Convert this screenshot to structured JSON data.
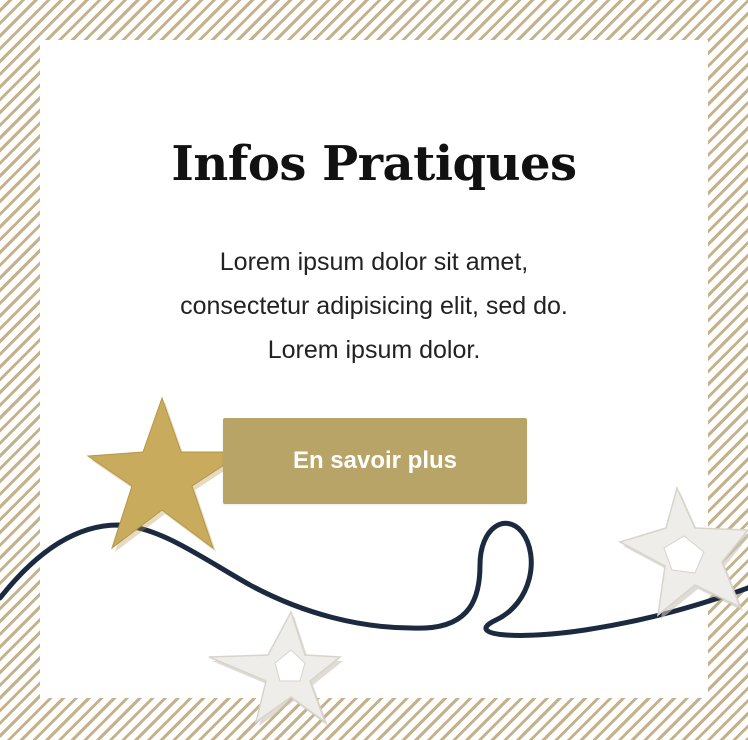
{
  "section": {
    "title": "Infos Pratiques",
    "body_lines": [
      "Lorem ipsum dolor sit amet,",
      "consectetur adipisicing elit, sed do.",
      "Lorem ipsum dolor."
    ],
    "cta_label": "En savoir plus"
  },
  "decorations": {
    "string": "navy-twine",
    "stars": [
      "gold-glitter-star-icon",
      "white-wooden-star-icon",
      "white-wooden-star-icon"
    ]
  },
  "colors": {
    "stripe": "#c5b28a",
    "button": "#b9a468",
    "button_text": "#ffffff",
    "title": "#111111",
    "string": "#1c2a40",
    "gold_star": "#c8ab5c",
    "white_star": "#efedea"
  }
}
